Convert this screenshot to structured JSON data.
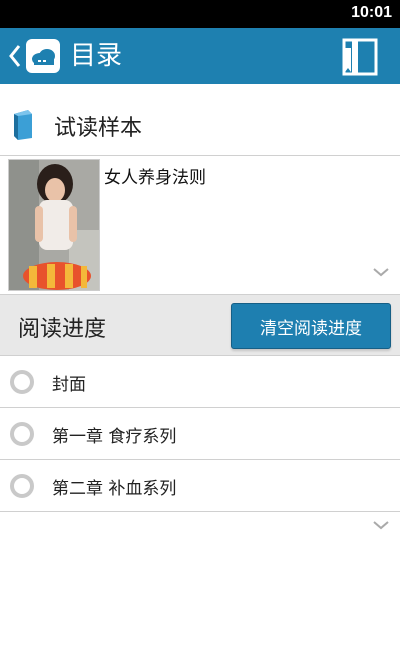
{
  "status_bar": {
    "time": "10:01"
  },
  "app_bar": {
    "title": "目录",
    "back_icon": "chevron-left-icon",
    "app_icon": "cloud-icon",
    "action_icon": "bookmark-icon"
  },
  "sample": {
    "label": "试读样本",
    "icon": "book-icon"
  },
  "book": {
    "title": "女人养身法则"
  },
  "progress": {
    "label": "阅读进度",
    "clear_button": "清空阅读进度"
  },
  "chapters": [
    {
      "label": "封面"
    },
    {
      "label": "第一章 食疗系列"
    },
    {
      "label": "第二章 补血系列"
    }
  ],
  "colors": {
    "accent": "#1e80b0",
    "status_bar": "#000000",
    "header_gray": "#e8e8e8"
  }
}
